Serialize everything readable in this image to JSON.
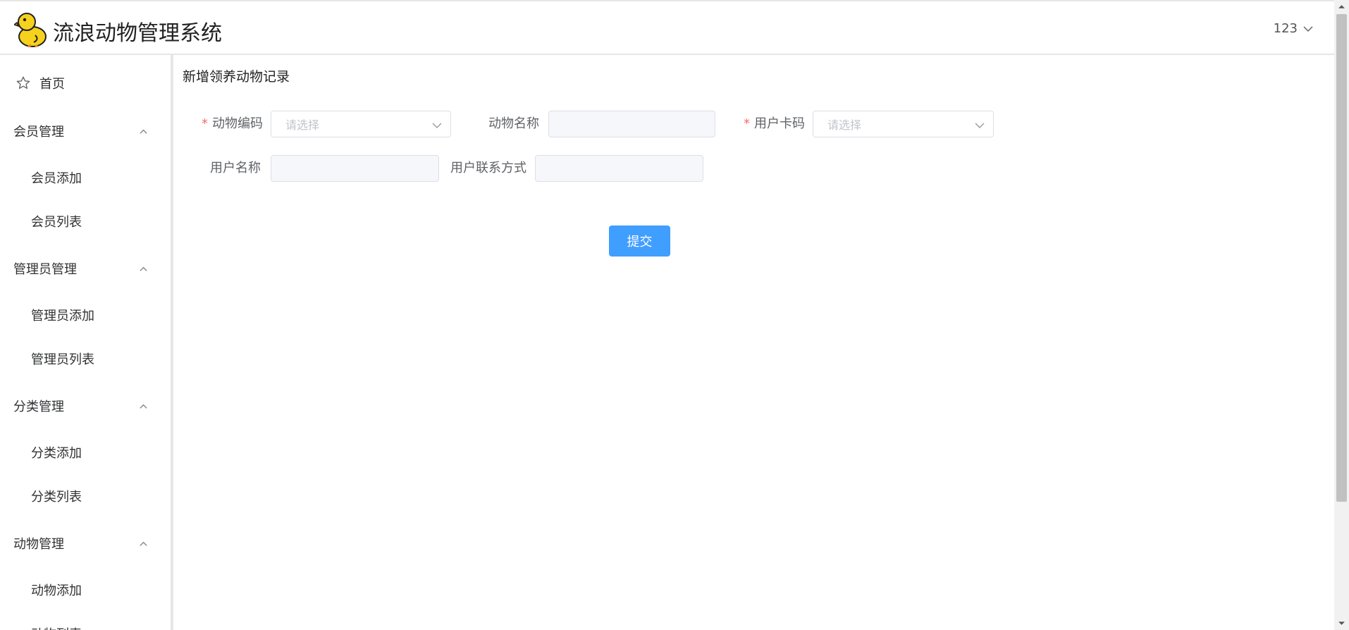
{
  "header": {
    "title": "流浪动物管理系统",
    "user": "123",
    "logo_icon": "duck-logo-icon",
    "user_chevron_icon": "chevron-down-icon"
  },
  "sidebar": {
    "home": "首页",
    "home_icon": "star-icon",
    "groups": [
      {
        "label": "会员管理",
        "items": [
          "会员添加",
          "会员列表"
        ]
      },
      {
        "label": "管理员管理",
        "items": [
          "管理员添加",
          "管理员列表"
        ]
      },
      {
        "label": "分类管理",
        "items": [
          "分类添加",
          "分类列表"
        ]
      },
      {
        "label": "动物管理",
        "items": [
          "动物添加",
          "动物列表"
        ]
      }
    ],
    "group_chevron_icon": "chevron-up-icon"
  },
  "main": {
    "page_title": "新增领养动物记录",
    "form": {
      "required_mark": "*",
      "animal_code": {
        "label": "动物编码",
        "placeholder": "请选择"
      },
      "animal_name": {
        "label": "动物名称",
        "value": ""
      },
      "user_card": {
        "label": "用户卡码",
        "placeholder": "请选择"
      },
      "user_name": {
        "label": "用户名称",
        "value": ""
      },
      "user_contact": {
        "label": "用户联系方式",
        "value": ""
      },
      "submit_label": "提交"
    }
  },
  "colors": {
    "primary": "#409eff",
    "required": "#f56c6c",
    "readonly_bg": "#f5f7fa"
  }
}
